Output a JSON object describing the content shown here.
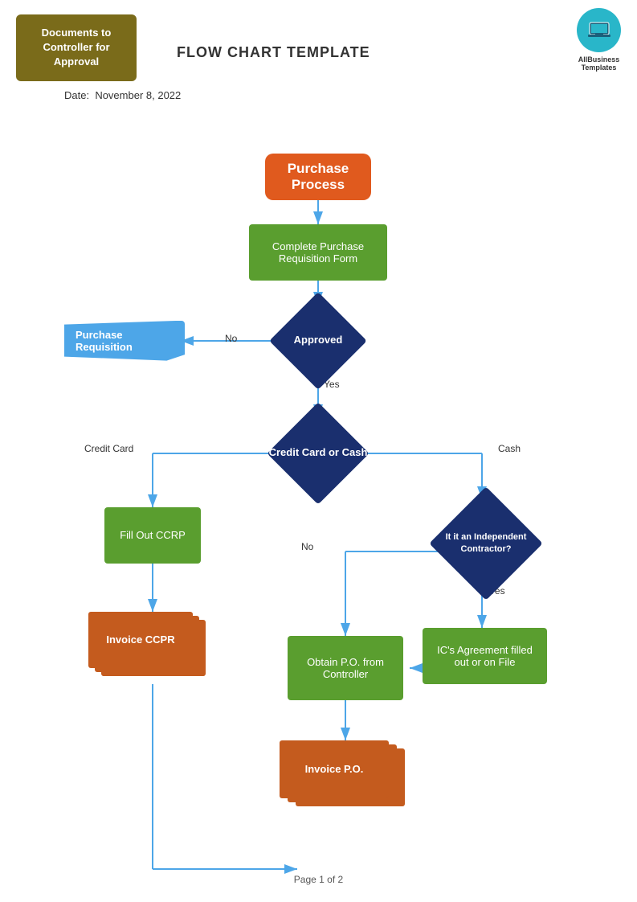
{
  "header": {
    "docs_box": "Documents to\nController for\nApproval",
    "title": "FLOW CHART TEMPLATE",
    "date_label": "Date:",
    "date_value": "November 8, 2022",
    "logo_text1": "AllBusiness",
    "logo_text2": "Templates"
  },
  "flowchart": {
    "start_label": "Purchase\nProcess",
    "step1_label": "Complete Purchase\nRequisition Form",
    "diamond1_label": "Approved",
    "purchase_req_label": "Purchase Requisition",
    "diamond2_label": "Credit Card or Cash",
    "credit_card_label": "Credit Card",
    "cash_label": "Cash",
    "no_label1": "No",
    "yes_label1": "Yes",
    "no_label2": "No",
    "yes_label2": "Yes",
    "fill_ccrp_label": "Fill Out CCRP",
    "invoice_ccpr_label": "Invoice CCPR",
    "diamond3_label": "It it an Independent\nContractor?",
    "obtain_po_label": "Obtain P.O. from\nController",
    "ics_agreement_label": "IC's Agreement filled\nout or on File",
    "invoice_po_label": "Invoice P.O.",
    "page_label": "Page 1 of 2"
  }
}
